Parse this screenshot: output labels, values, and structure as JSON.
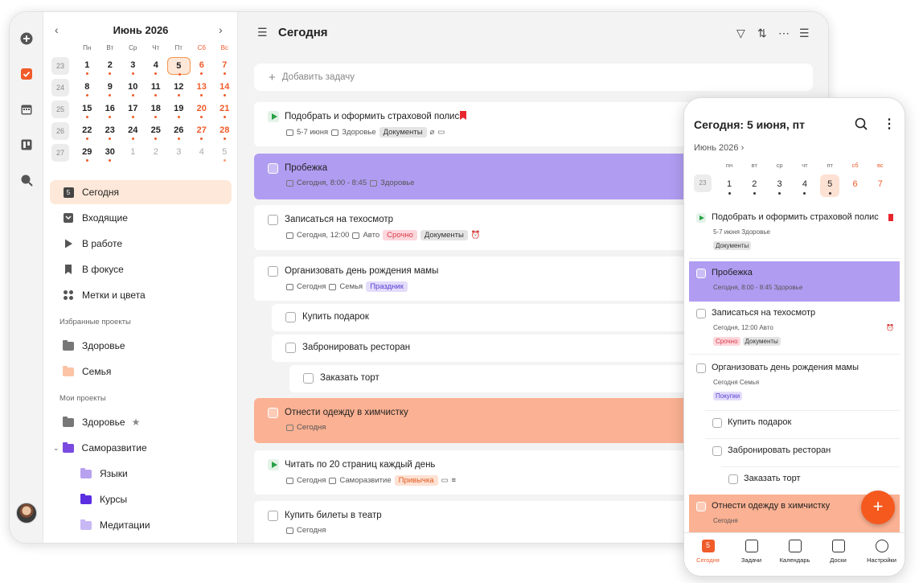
{
  "calendar": {
    "month_title": "Июнь 2026",
    "weekdays": [
      "Пн",
      "Вт",
      "Ср",
      "Чт",
      "Пт",
      "Сб",
      "Вс"
    ],
    "weeks": [
      {
        "num": "23",
        "days": [
          "1",
          "2",
          "3",
          "4",
          "5",
          "6",
          "7"
        ]
      },
      {
        "num": "24",
        "days": [
          "8",
          "9",
          "10",
          "11",
          "12",
          "13",
          "14"
        ]
      },
      {
        "num": "25",
        "days": [
          "15",
          "16",
          "17",
          "18",
          "19",
          "20",
          "21"
        ]
      },
      {
        "num": "26",
        "days": [
          "22",
          "23",
          "24",
          "25",
          "26",
          "27",
          "28"
        ]
      },
      {
        "num": "27",
        "days": [
          "29",
          "30",
          "1",
          "2",
          "3",
          "4",
          "5"
        ]
      }
    ],
    "selected_day": "5"
  },
  "sidebar": {
    "today_badge": "5",
    "nav": [
      "Сегодня",
      "Входящие",
      "В работе",
      "В фокусе",
      "Метки и цвета"
    ],
    "fav_label": "Избранные проекты",
    "fav": [
      "Здоровье",
      "Семья"
    ],
    "my_label": "Мои проекты",
    "my": [
      "Здоровье",
      "Саморазвитие",
      "Языки",
      "Курсы",
      "Медитации"
    ]
  },
  "main": {
    "title": "Сегодня",
    "add_placeholder": "Добавить задачу",
    "tasks": [
      {
        "title": "Подобрать и оформить страховой полис",
        "meta": [
          "5-7 июня",
          "Здоровье"
        ],
        "tags": [
          "Документы"
        ]
      },
      {
        "title": "Пробежка",
        "meta": [
          "Сегодня, 8:00 - 8:45",
          "Здоровье"
        ],
        "tags": []
      },
      {
        "title": "Записаться на техосмотр",
        "meta": [
          "Сегодня, 12:00",
          "Авто"
        ],
        "tags": [
          "Срочно",
          "Документы"
        ]
      },
      {
        "title": "Организовать день рождения мамы",
        "meta": [
          "Сегодня",
          "Семья"
        ],
        "tags": [
          "Праздник"
        ]
      },
      {
        "title": "Купить подарок"
      },
      {
        "title": "Забронировать ресторан"
      },
      {
        "title": "Заказать торт"
      },
      {
        "title": "Отнести одежду в химчистку",
        "meta": [
          "Сегодня"
        ],
        "tags": []
      },
      {
        "title": "Читать по 20 страниц каждый день",
        "meta": [
          "Сегодня",
          "Саморазвитие"
        ],
        "tags": [
          "Привычка"
        ]
      },
      {
        "title": "Купить билеты в театр",
        "meta": [
          "Сегодня"
        ],
        "tags": []
      }
    ]
  },
  "phone": {
    "title": "Сегодня: 5 июня, пт",
    "month": "Июнь 2026",
    "week_num": "23",
    "weekdays": [
      "пн",
      "вт",
      "ср",
      "чт",
      "пт",
      "сб",
      "вс"
    ],
    "days": [
      "1",
      "2",
      "3",
      "4",
      "5",
      "6",
      "7"
    ],
    "tasks": [
      {
        "title": "Подобрать и оформить страховой полис",
        "meta": "5-7 июня  Здоровье",
        "tags": [
          "Документы"
        ]
      },
      {
        "title": "Пробежка",
        "meta": "Сегодня, 8:00 - 8:45  Здоровье",
        "tags": []
      },
      {
        "title": "Записаться на техосмотр",
        "meta": "Сегодня, 12:00  Авто",
        "tags": [
          "Срочно",
          "Документы"
        ]
      },
      {
        "title": "Организовать день рождения мамы",
        "meta": "Сегодня  Семья",
        "tags": [
          "Покупки"
        ]
      },
      {
        "title": "Купить подарок"
      },
      {
        "title": "Забронировать ресторан"
      },
      {
        "title": "Заказать торт"
      },
      {
        "title": "Отнести одежду в химчистку",
        "meta": "Сегодня",
        "tags": []
      }
    ],
    "fab": "+",
    "today_badge": "5",
    "tabs": [
      "Сегодня",
      "Задачи",
      "Календарь",
      "Доски",
      "Настройки"
    ]
  },
  "colors": {
    "accent": "#f05b2a",
    "purple": "#b09cf1",
    "orange": "#fbb193",
    "green": "#27a046"
  },
  "icons": {
    "rail": [
      "plus-circle-icon",
      "checkbox-icon",
      "calendar-icon",
      "board-icon",
      "search-icon"
    ]
  }
}
